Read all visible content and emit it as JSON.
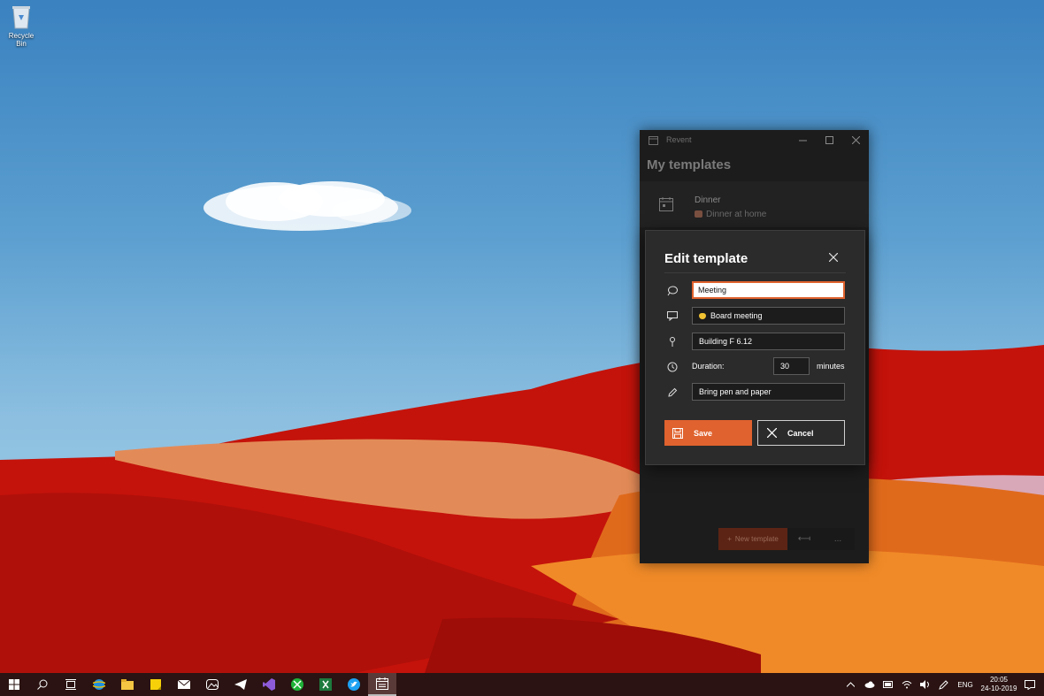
{
  "desktop": {
    "recycle_bin_label": "Recycle Bin"
  },
  "app": {
    "window_title": "Revent",
    "page_title": "My templates",
    "templates": [
      {
        "name": "Dinner",
        "description": "Dinner at home",
        "icon": "calendar-icon"
      }
    ],
    "bottom_bar": {
      "new_template_label": "New template",
      "more_label": "..."
    }
  },
  "dialog": {
    "title": "Edit template",
    "title_value": "Meeting",
    "subject_value": "Board meeting",
    "location_value": "Building F 6.12",
    "duration_label": "Duration:",
    "duration_value": "30",
    "duration_unit": "minutes",
    "notes_value": "Bring pen and paper",
    "save_label": "Save",
    "cancel_label": "Cancel"
  },
  "taskbar": {
    "pinned_apps": [
      "windows-start",
      "search",
      "task-view",
      "ie",
      "file-explorer",
      "sticky-notes",
      "mail",
      "photos",
      "telegram",
      "visual-studio",
      "xbox",
      "excel",
      "twitter",
      "revent"
    ],
    "active_app": "revent",
    "language": "ENG",
    "time": "20:05",
    "date": "24-10-2019"
  },
  "colors": {
    "accent": "#e0622e",
    "dialog_bg": "#2b2b2b",
    "app_bg": "#1c1c1c",
    "taskbar_bg": "#2a1312"
  }
}
